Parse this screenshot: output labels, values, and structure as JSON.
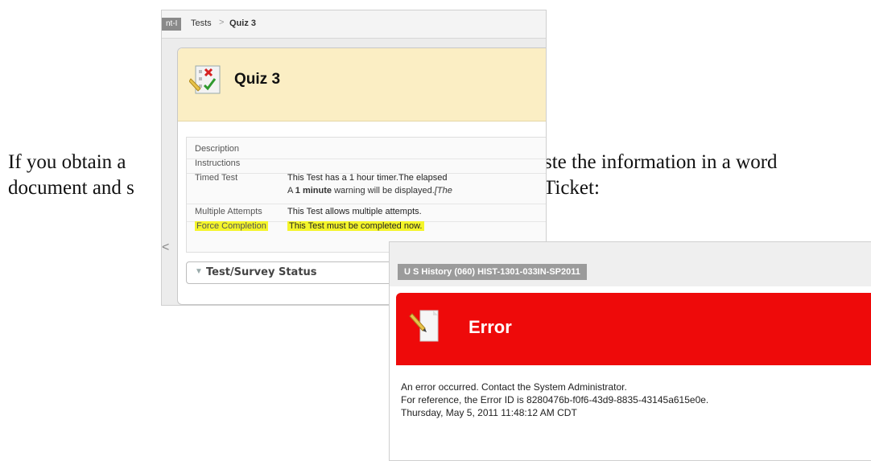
{
  "document": {
    "line1_left": "If you obtain a",
    "line1_right": "ste the information in a word",
    "line2_left": "document and s",
    "line2_right": "Ticket:"
  },
  "quiz": {
    "course_tab": "nt-I",
    "breadcrumb": {
      "parent": "Tests",
      "separator": ">",
      "current": "Quiz 3"
    },
    "title": "Quiz 3",
    "rows": [
      {
        "label": "Description",
        "value": ""
      },
      {
        "label": "Instructions",
        "value": ""
      },
      {
        "label": "Timed Test",
        "value": "This Test has a 1 hour timer.The elapsed",
        "value2_pre": "A ",
        "value2_bold": "1 minute",
        "value2_post": " warning will be displayed.",
        "value2_italic": "[The"
      },
      {
        "label": "Multiple Attempts",
        "value": "This Test allows multiple attempts."
      },
      {
        "label": "Force Completion",
        "value": "This Test must be completed now."
      }
    ],
    "status_section": "Test/Survey Status",
    "left_arrow": "<"
  },
  "error": {
    "course": "U S History (060) HIST-1301-033IN-SP2011",
    "title": "Error",
    "message_lines": [
      "An error occurred. Contact the System Administrator.",
      "For reference, the Error ID is 8280476b-f0f6-43d9-8835-43145a615e0e.",
      "Thursday, May 5, 2011 11:48:12 AM CDT"
    ]
  },
  "colors": {
    "quiz_header": "#fbeec4",
    "highlight": "#f4f52a",
    "error_banner": "#ee0a0a"
  }
}
